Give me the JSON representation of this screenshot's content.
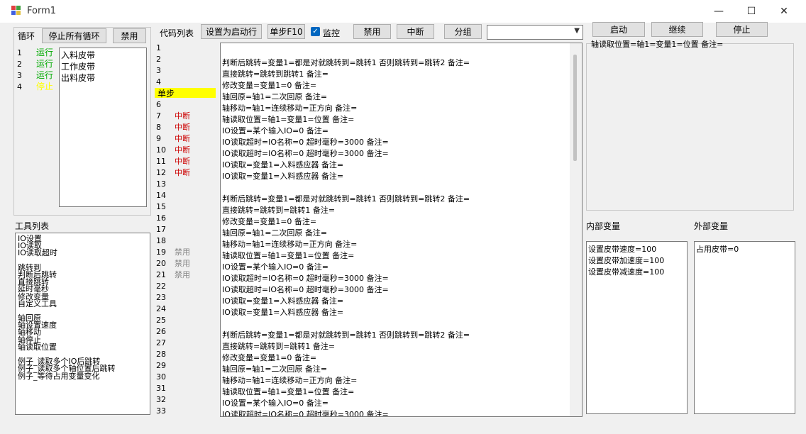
{
  "window": {
    "title": "Form1",
    "minimize_glyph": "—",
    "maximize_glyph": "☐",
    "close_glyph": "✕"
  },
  "loop_panel": {
    "label": "循环",
    "stop_all_button": "停止所有循环",
    "disable_button": "禁用",
    "numbers": [
      "1",
      "2",
      "3",
      "4"
    ],
    "statuses": [
      {
        "text": "运行",
        "color": "#00aa00"
      },
      {
        "text": "运行",
        "color": "#00aa00"
      },
      {
        "text": "运行",
        "color": "#00aa00"
      },
      {
        "text": "停止",
        "color": "#ffff00"
      }
    ],
    "items": [
      "入料皮带",
      "工作皮带",
      "出料皮带"
    ]
  },
  "tool_panel": {
    "label": "工具列表",
    "items": [
      "IO设置",
      "IO读取",
      "IO读取超时",
      "",
      "跳转到",
      "判断后跳转",
      "直接跳转",
      "延时毫秒",
      "修改变量",
      "自定义工具",
      "",
      "轴回原",
      "轴设置速度",
      "轴移动",
      "轴停止",
      "轴读取位置",
      "",
      "例子_读取多个IO后跳转",
      "例子_读取多个轴位置后跳转",
      "例子_等待占用变量变化"
    ]
  },
  "toolbar": {
    "code_list_label": "代码列表",
    "set_start_button": "设置为启动行",
    "step_button": "单步F10",
    "monitor_label": "监控",
    "disable_button": "禁用",
    "interrupt_button": "中断",
    "group_button": "分组",
    "dropdown_value": ""
  },
  "code_gutter": {
    "line_numbers": [
      "1",
      "2",
      "3",
      "4",
      "5",
      "6",
      "7",
      "8",
      "9",
      "10",
      "11",
      "12",
      "13",
      "14",
      "15",
      "16",
      "17",
      "18",
      "19",
      "20",
      "21",
      "22",
      "23",
      "24",
      "25",
      "26",
      "27",
      "28",
      "29",
      "30",
      "31",
      "32",
      "33"
    ],
    "step_label": "单步",
    "interrupt_color": "#cc0000",
    "disabled_color": "#888888",
    "step_highlight_color": "#ffff00",
    "markers": [
      "",
      "",
      "",
      "",
      "",
      "",
      "中断",
      "中断",
      "中断",
      "中断",
      "中断",
      "中断",
      "",
      "",
      "",
      "",
      "",
      "",
      "禁用",
      "禁用",
      "禁用",
      "",
      "",
      "",
      "",
      "",
      "",
      "",
      "",
      "",
      "",
      "",
      ""
    ]
  },
  "code_lines": [
    "",
    "判断后跳转=变量1=都是对就跳转到=跳转1 否则跳转到=跳转2   备注=",
    "直接跳转=跳转到跳转1   备注=",
    "修改变量=变量1=0   备注=",
    "轴回原=轴1=二次回原   备注=",
    "轴移动=轴1=连续移动=正方向   备注=",
    "轴读取位置=轴1=变量1=位置   备注=",
    "IO设置=某个输入IO=0   备注=",
    "IO读取超时=IO名称=0 超时毫秒=3000   备注=",
    "IO读取超时=IO名称=0 超时毫秒=3000   备注=",
    "IO读取=变量1=入料感应器   备注=",
    "IO读取=变量1=入料感应器   备注=",
    "",
    "判断后跳转=变量1=都是对就跳转到=跳转1 否则跳转到=跳转2   备注=",
    "直接跳转=跳转到=跳转1   备注=",
    "修改变量=变量1=0   备注=",
    "轴回原=轴1=二次回原   备注=",
    "轴移动=轴1=连续移动=正方向   备注=",
    "轴读取位置=轴1=变量1=位置   备注=",
    "IO设置=某个输入IO=0   备注=",
    "IO读取超时=IO名称=0 超时毫秒=3000   备注=",
    "IO读取超时=IO名称=0 超时毫秒=3000   备注=",
    "IO读取=变量1=入料感应器   备注=",
    "IO读取=变量1=入料感应器   备注=",
    "",
    "判断后跳转=变量1=都是对就跳转到=跳转1 否则跳转到=跳转2   备注=",
    "直接跳转=跳转到=跳转1   备注=",
    "修改变量=变量1=0   备注=",
    "轴回原=轴1=二次回原   备注=",
    "轴移动=轴1=连续移动=正方向   备注=",
    "轴读取位置=轴1=变量1=位置   备注=",
    "IO设置=某个输入IO=0   备注=",
    "IO读取超时=IO名称=0 超时毫秒=3000   备注="
  ],
  "right_panel": {
    "start_button": "启动",
    "continue_button": "继续",
    "stop_button": "停止",
    "detail_text": "轴读取位置=轴1=变量1=位置   备注=",
    "internal_vars_label": "内部变量",
    "external_vars_label": "外部变量",
    "internal_vars": [
      "设置皮带速度=100",
      "设置皮带加速度=100",
      "设置皮带减速度=100"
    ],
    "external_vars": [
      "占用皮带=0"
    ]
  }
}
